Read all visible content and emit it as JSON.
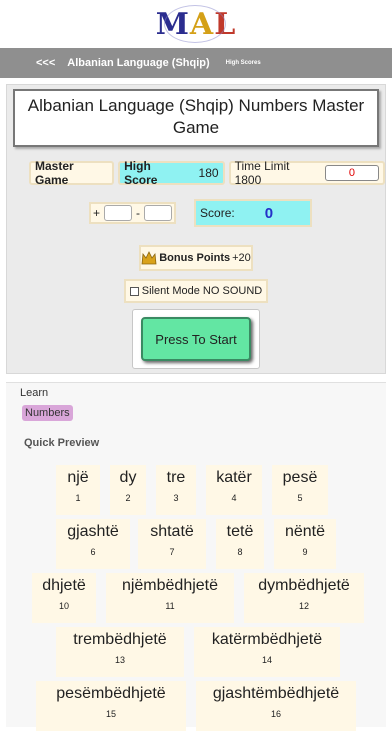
{
  "logo": {
    "letters": [
      "M",
      "A",
      "L"
    ]
  },
  "nav": {
    "back": "<<<",
    "title": "Albanian Language (Shqip)",
    "high_scores": "High Scores"
  },
  "title": "Albanian Language (Shqip) Numbers Master Game",
  "stats": {
    "master_game": "Master Game",
    "high_score_label": "High Score",
    "high_score_value": "180",
    "time_limit_label": "Time Limit 1800",
    "time_value": "0"
  },
  "answer": {
    "plus": "+",
    "minus": "-",
    "score_label": "Score:",
    "score_value": "0"
  },
  "bonus": {
    "label": "Bonus Points",
    "value": "+20"
  },
  "silent": {
    "label": "Silent Mode NO SOUND"
  },
  "start": {
    "label": "Press To Start"
  },
  "learn": {
    "label": "Learn",
    "tag": "Numbers",
    "quick_preview": "Quick Preview"
  },
  "words": [
    {
      "word": "një",
      "num": "1"
    },
    {
      "word": "dy",
      "num": "2"
    },
    {
      "word": "tre",
      "num": "3"
    },
    {
      "word": "katër",
      "num": "4"
    },
    {
      "word": "pesë",
      "num": "5"
    },
    {
      "word": "gjashtë",
      "num": "6"
    },
    {
      "word": "shtatë",
      "num": "7"
    },
    {
      "word": "tetë",
      "num": "8"
    },
    {
      "word": "nëntë",
      "num": "9"
    },
    {
      "word": "dhjetë",
      "num": "10"
    },
    {
      "word": "njëmbëdhjetë",
      "num": "11"
    },
    {
      "word": "dymbëdhjetë",
      "num": "12"
    },
    {
      "word": "trembëdhjetë",
      "num": "13"
    },
    {
      "word": "katërmbëdhjetë",
      "num": "14"
    },
    {
      "word": "pesëmbëdhjetë",
      "num": "15"
    },
    {
      "word": "gjashtëmbëdhjetë",
      "num": "16"
    }
  ],
  "colors": {
    "nav": "#8f8f8f",
    "cyan": "#8ff2f2",
    "start": "#63e6a3",
    "tag": "#d9a6d9",
    "score": "#2430c8",
    "time": "#e00000"
  }
}
